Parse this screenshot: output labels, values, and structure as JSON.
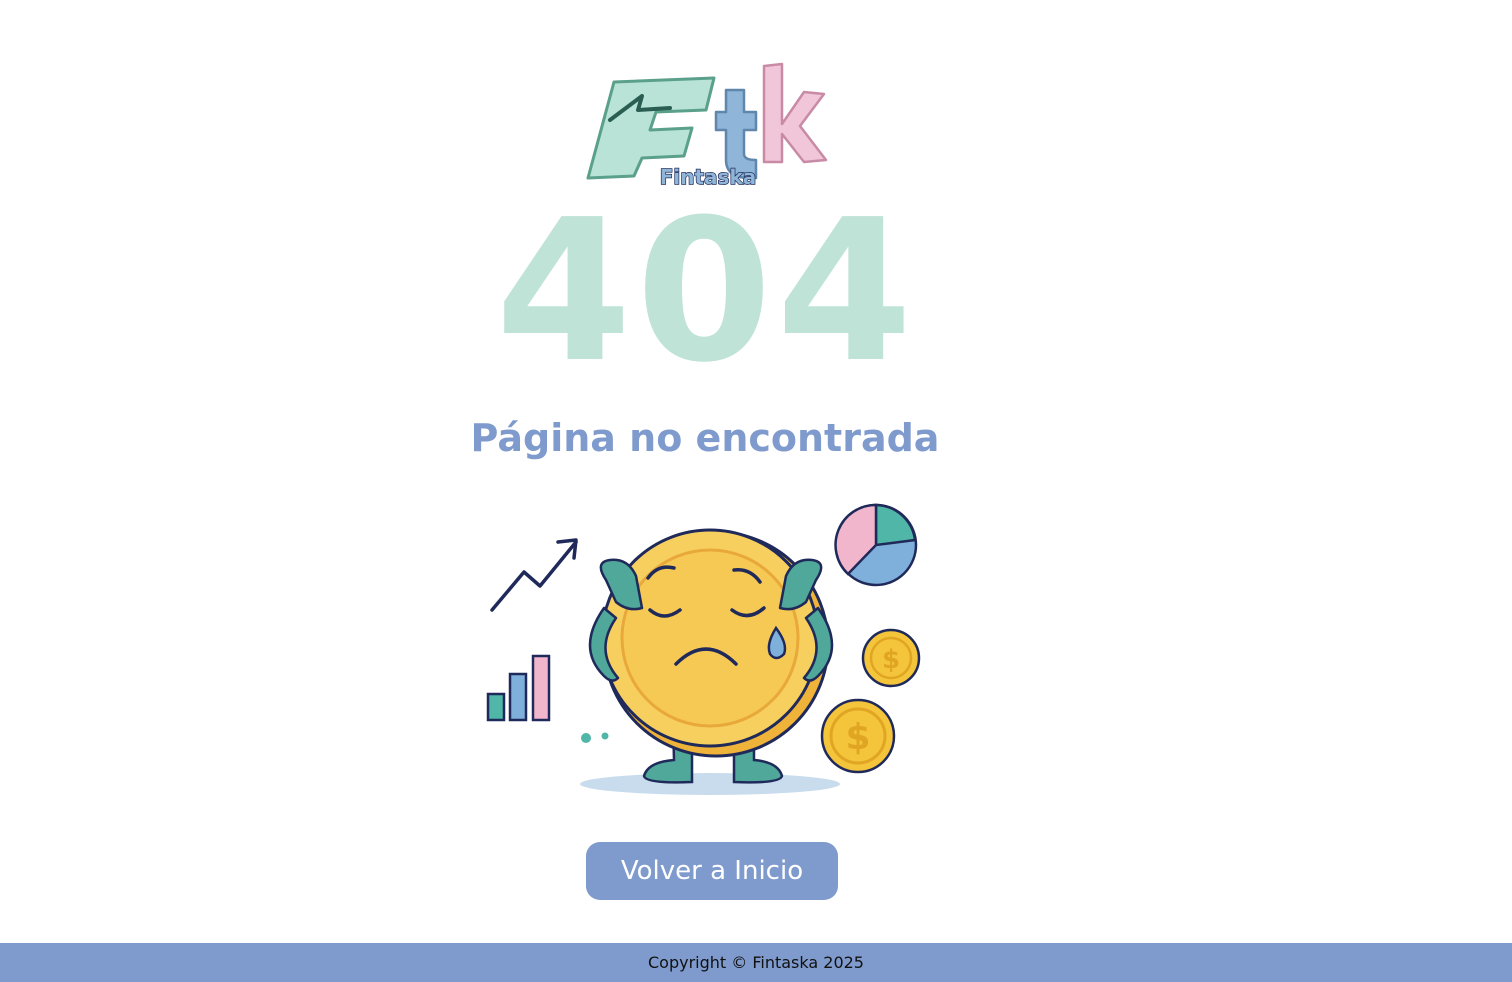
{
  "logo": {
    "mark": "Ftk",
    "name": "Fintaska",
    "colors": {
      "f": "#b8e3d6",
      "t": "#8fb5d8",
      "k": "#f0c6d8",
      "name": "#1f2a5a"
    }
  },
  "error": {
    "code": "404",
    "message": "Página no encontrada"
  },
  "illustration": {
    "icon": "sad-coin-illustration",
    "elements": [
      "trend-arrow-icon",
      "bar-chart-icon",
      "pie-chart-icon",
      "dollar-coin-icon",
      "dollar-coin-icon"
    ]
  },
  "actions": {
    "home_label": "Volver a Inicio"
  },
  "footer": {
    "copyright": "Copyright © Fintaska 2025"
  },
  "colors": {
    "accent": "#7f9bcd",
    "code": "#bfe3d6",
    "background": "#ffffff"
  }
}
